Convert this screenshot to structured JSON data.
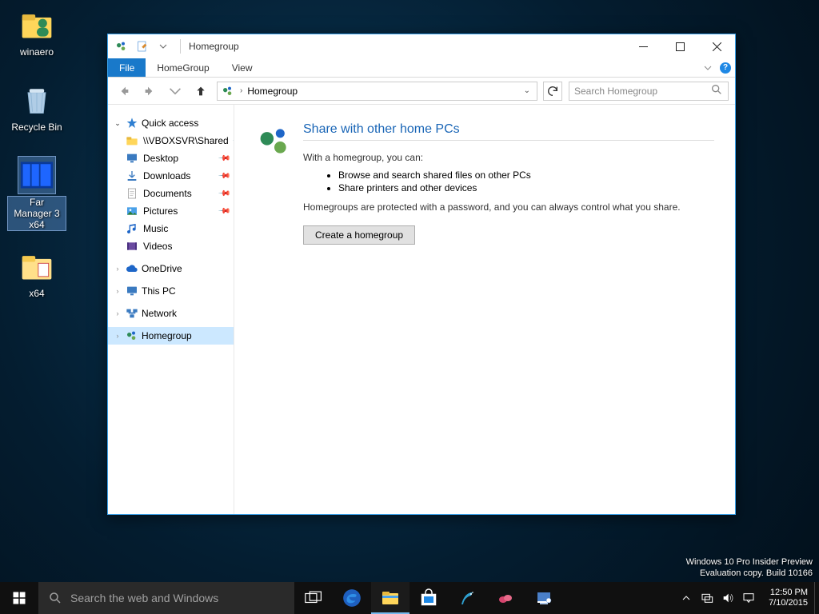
{
  "desktop": {
    "icons": [
      {
        "name": "winaero-icon",
        "label": "winaero"
      },
      {
        "name": "recycle-bin-icon",
        "label": "Recycle Bin"
      },
      {
        "name": "far-manager-icon",
        "label": "Far Manager 3 x64",
        "selected": true
      },
      {
        "name": "x64-folder-icon",
        "label": "x64"
      }
    ]
  },
  "watermark": {
    "line1": "Windows 10 Pro Insider Preview",
    "line2": "Evaluation copy. Build 10166"
  },
  "explorer": {
    "title": "Homegroup",
    "tabs": {
      "file": "File",
      "tab2": "HomeGroup",
      "tab3": "View"
    },
    "address": {
      "location": "Homegroup"
    },
    "search": {
      "placeholder": "Search Homegroup"
    },
    "nav": {
      "quick_access": "Quick access",
      "qa_items": [
        {
          "label": "\\\\VBOXSVR\\Shared",
          "pin": true,
          "icon": "net-folder"
        },
        {
          "label": "Desktop",
          "pin": true,
          "icon": "desktop"
        },
        {
          "label": "Downloads",
          "pin": true,
          "icon": "downloads"
        },
        {
          "label": "Documents",
          "pin": true,
          "icon": "documents"
        },
        {
          "label": "Pictures",
          "pin": true,
          "icon": "pictures"
        },
        {
          "label": "Music",
          "pin": false,
          "icon": "music"
        },
        {
          "label": "Videos",
          "pin": false,
          "icon": "videos"
        }
      ],
      "onedrive": "OneDrive",
      "thispc": "This PC",
      "network": "Network",
      "homegroup": "Homegroup"
    },
    "content": {
      "title": "Share with other home PCs",
      "intro": "With a homegroup, you can:",
      "bullets": [
        "Browse and search shared files on other PCs",
        "Share printers and other devices"
      ],
      "footer": "Homegroups are protected with a password, and you can always control what you share.",
      "button": "Create a homegroup"
    }
  },
  "taskbar": {
    "search_placeholder": "Search the web and Windows",
    "clock": {
      "time": "12:50 PM",
      "date": "7/10/2015"
    }
  }
}
